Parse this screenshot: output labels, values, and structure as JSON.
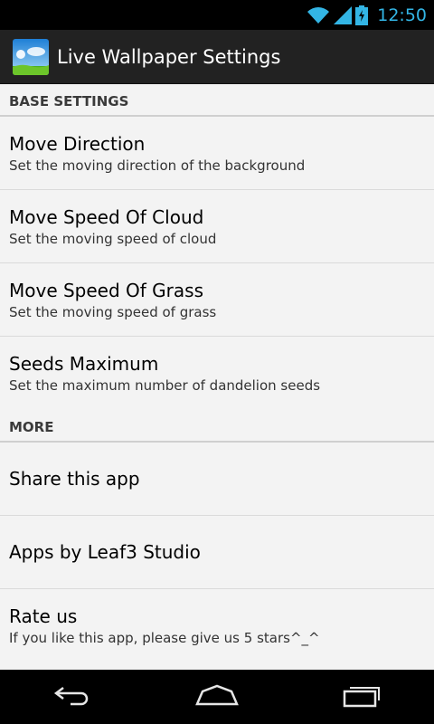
{
  "status_bar": {
    "time": "12:50",
    "accent_color": "#33b5e5",
    "icons": [
      "wifi-icon",
      "signal-icon",
      "battery-charging-icon"
    ]
  },
  "action_bar": {
    "title": "Live Wallpaper Settings",
    "icon": "app-icon"
  },
  "sections": [
    {
      "header": "BASE SETTINGS",
      "items": [
        {
          "title": "Move Direction",
          "summary": "Set the moving direction of the background"
        },
        {
          "title": "Move Speed Of Cloud",
          "summary": "Set the moving speed of cloud"
        },
        {
          "title": "Move Speed Of Grass",
          "summary": "Set the moving speed of grass"
        },
        {
          "title": "Seeds Maximum",
          "summary": "Set the maximum number of dandelion seeds"
        }
      ]
    },
    {
      "header": "MORE",
      "items": [
        {
          "title": "Share this app"
        },
        {
          "title": "Apps by Leaf3 Studio"
        },
        {
          "title": "Rate us",
          "summary": "If you like this app, please give us 5 stars^_^"
        }
      ]
    }
  ],
  "nav_bar": {
    "buttons": [
      "back-icon",
      "home-icon",
      "recent-apps-icon"
    ]
  }
}
